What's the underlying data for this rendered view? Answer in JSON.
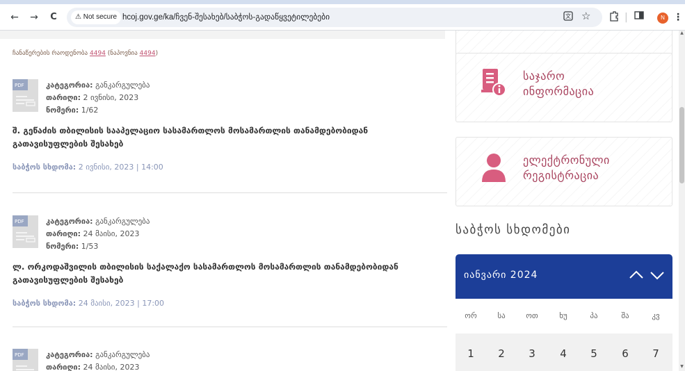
{
  "browser": {
    "back_icon": "←",
    "forward_icon": "→",
    "reload_icon": "C",
    "security_label": "Not secure",
    "url": "hcoj.gov.ge/ka/ჩვენ-შესახებ/საბჭოს-გადაწყვეტილებები",
    "profile_initial": "N"
  },
  "page": {
    "records_label": "ჩანაწერების რაოდენობა",
    "records_count": "4494",
    "found_label": "(ნაპოვნია",
    "found_count": "4494",
    "found_close": ")"
  },
  "entries": [
    {
      "category_label": "კატეგორია:",
      "category": "განკარგულება",
      "date_label": "თარიღი:",
      "date": "2 ივნისი, 2023",
      "number_label": "ნომერი:",
      "number": "1/62",
      "title": "შ. გეწაძის თბილისის სააპელაციო სასამართლოს მოსამართლის თანამდებობიდან გათავისუფლების შესახებ",
      "hearing_label": "საბჭოს სხდომა:",
      "hearing": "2 ივნისი, 2023 | 14:00"
    },
    {
      "category_label": "კატეგორია:",
      "category": "განკარგულება",
      "date_label": "თარიღი:",
      "date": "24 მაისი, 2023",
      "number_label": "ნომერი:",
      "number": "1/53",
      "title": "ლ. ორკოდაშვილის თბილისის საქალაქო სასამართლოს მოსამართლის თანამდებობიდან გათავისუფლების შესახებ",
      "hearing_label": "საბჭოს სხდომა:",
      "hearing": "24 მაისი, 2023 | 17:00"
    },
    {
      "category_label": "კატეგორია:",
      "category": "განკარგულება",
      "date_label": "თარიღი:",
      "date": "24 მაისი, 2023"
    }
  ],
  "pdf_badge": "PDF",
  "sidebar": {
    "public_info": [
      "საჯარო",
      "ინფორმაცია"
    ],
    "e_registration": [
      "ელექტრონული",
      "რეგისტრაცია"
    ],
    "hearings_title": "საბჭოს სხდომები"
  },
  "calendar": {
    "month": "იანვარი 2024",
    "weekdays": [
      "ორ",
      "სა",
      "ოთ",
      "ხუ",
      "პა",
      "შა",
      "კვ"
    ],
    "dates": [
      "1",
      "2",
      "3",
      "4",
      "5",
      "6",
      "7"
    ]
  },
  "colors": {
    "accent": "#a8425d",
    "calendar_header": "#1c3e98",
    "link": "#c0506f"
  }
}
